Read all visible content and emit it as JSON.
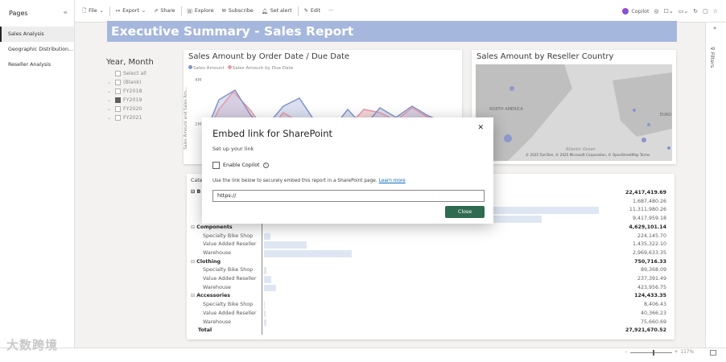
{
  "pages_pane": {
    "title": "Pages",
    "items": [
      {
        "label": "Sales Analysis",
        "active": true
      },
      {
        "label": "Geographic Distribution..."
      },
      {
        "label": "Reseller Analysis"
      }
    ]
  },
  "toolbar": {
    "file": "File",
    "export": "Export",
    "share": "Share",
    "explore": "Explore",
    "subscribe": "Subscribe",
    "set_alert": "Set alert",
    "edit": "Edit",
    "more": "···",
    "copilot": "Copilot"
  },
  "report": {
    "title": "Executive Summary - Sales Report",
    "slicer": {
      "title": "Year, Month",
      "options": [
        {
          "label": "Select all",
          "chevron": false,
          "checked": false
        },
        {
          "label": "(Blank)",
          "chevron": true,
          "checked": false
        },
        {
          "label": "FY2018",
          "chevron": true,
          "checked": false
        },
        {
          "label": "FY2019",
          "chevron": true,
          "checked": true
        },
        {
          "label": "FY2020",
          "chevron": true,
          "checked": false
        },
        {
          "label": "FY2021",
          "chevron": true,
          "checked": false
        }
      ]
    },
    "line_visual": {
      "title": "Sales Amount by Order Date / Due Date",
      "legend": [
        "Sales Amount",
        "Sales Amount by Due Date"
      ],
      "y_label": "Sales Amount and Sales Am...",
      "y_ticks": [
        "4M",
        "2M"
      ]
    },
    "map_visual": {
      "title": "Sales Amount by Reseller Country",
      "labels": [
        "NORTH AMERICA",
        "EURO",
        "Atlantic Ocean"
      ],
      "attribution": "© 2025 TomTom, © 2025 Microsoft Corporation, © OpenStreetMap Terms",
      "bing": "Bing"
    },
    "matrix": {
      "header_partial": "Cate",
      "first_row_partial": "B",
      "rows": [
        {
          "label": "",
          "value": "22,417,419.69",
          "level": 0,
          "bold": true,
          "bar": 0
        },
        {
          "label": "",
          "value": "1,687,480.26",
          "level": 1,
          "bold": false,
          "bar": 0
        },
        {
          "label": "",
          "value": "11,311,980.26",
          "level": 1,
          "bold": false,
          "bar": 1.0
        },
        {
          "label": "",
          "value": "9,417,959.18",
          "level": 1,
          "bold": false,
          "bar": 0.83
        },
        {
          "label": "Components",
          "value": "4,629,101.14",
          "level": 0,
          "bold": true,
          "bar": 0
        },
        {
          "label": "Specialty Bike Shop",
          "value": "224,145.70",
          "level": 1,
          "bold": false,
          "bar": 0.02
        },
        {
          "label": "Value Added Reseller",
          "value": "1,435,322.10",
          "level": 1,
          "bold": false,
          "bar": 0.127
        },
        {
          "label": "Warehouse",
          "value": "2,969,633.35",
          "level": 1,
          "bold": false,
          "bar": 0.263
        },
        {
          "label": "Clothing",
          "value": "750,716.33",
          "level": 0,
          "bold": true,
          "bar": 0
        },
        {
          "label": "Specialty Bike Shop",
          "value": "89,368.09",
          "level": 1,
          "bold": false,
          "bar": 0.008
        },
        {
          "label": "Value Added Reseller",
          "value": "237,391.49",
          "level": 1,
          "bold": false,
          "bar": 0.021
        },
        {
          "label": "Warehouse",
          "value": "423,956.75",
          "level": 1,
          "bold": false,
          "bar": 0.037
        },
        {
          "label": "Accessories",
          "value": "124,433.35",
          "level": 0,
          "bold": true,
          "bar": 0
        },
        {
          "label": "Specialty Bike Shop",
          "value": "8,406.43",
          "level": 1,
          "bold": false,
          "bar": 0.001
        },
        {
          "label": "Value Added Reseller",
          "value": "40,366.23",
          "level": 1,
          "bold": false,
          "bar": 0.004
        },
        {
          "label": "Warehouse",
          "value": "75,660.69",
          "level": 1,
          "bold": false,
          "bar": 0.007
        },
        {
          "label": "Total",
          "value": "27,921,670.52",
          "level": 0,
          "bold": true,
          "bar": 0
        }
      ]
    }
  },
  "dialog": {
    "title": "Embed link for SharePoint",
    "subtitle": "Set up your link",
    "checkbox_label": "Enable Copilot",
    "description": "Use the link below to securely embed this report in a SharePoint page.",
    "learn_more": "Learn more",
    "link_value": "https://",
    "close_button": "Close"
  },
  "filters": {
    "label": "Filters"
  },
  "status": {
    "zoom": "117%",
    "watermark": "大数跨境"
  },
  "colors": {
    "accent": "#2f6b4f",
    "title_bg": "#a5b7dc",
    "series1": "#8496c8",
    "series2": "#e89aa8"
  }
}
